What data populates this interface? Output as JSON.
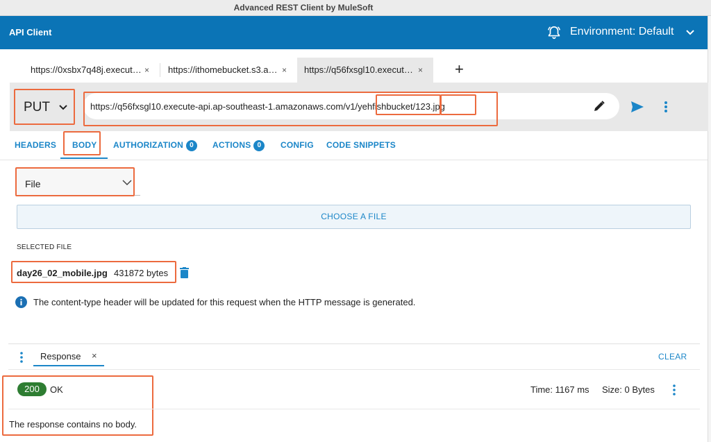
{
  "window": {
    "title": "Advanced REST Client by MuleSoft"
  },
  "header": {
    "app_title": "API Client",
    "environment_label": "Environment: Default",
    "bell_icon": "bell-alert-icon",
    "chevron_icon": "chevron-down-icon"
  },
  "tabs": [
    {
      "label": "https://0xsbx7q48j.execut…",
      "active": false
    },
    {
      "label": "https://ithomebucket.s3.a…",
      "active": false
    },
    {
      "label": "https://q56fxsgl10.execut…",
      "active": true
    }
  ],
  "tab_close_glyph": "×",
  "add_tab_glyph": "+",
  "request": {
    "method": "PUT",
    "url": "https://q56fxsgl10.execute-api.ap-southeast-1.amazonaws.com/v1/yehfishbucket/123.jpg"
  },
  "request_tabs": {
    "headers": "HEADERS",
    "body": "BODY",
    "authorization": "AUTHORIZATION",
    "authorization_count": "0",
    "actions": "ACTIONS",
    "actions_count": "0",
    "config": "CONFIG",
    "code_snippets": "CODE SNIPPETS"
  },
  "body_editor": {
    "type_selected": "File",
    "choose_file_label": "CHOOSE A FILE",
    "selected_file_label": "SELECTED FILE",
    "file_name": "day26_02_mobile.jpg",
    "file_size": "431872 bytes",
    "info_text": "The content-type header will be updated for this request when the HTTP message is generated."
  },
  "response": {
    "tab_label": "Response",
    "close_glyph": "×",
    "clear_label": "CLEAR",
    "status_code": "200",
    "status_text": "OK",
    "time_text": "Time: 1167 ms",
    "size_text": "Size: 0 Bytes",
    "no_body_text": "The response contains no body."
  },
  "colors": {
    "app_bar": "#0b74b6",
    "accent": "#1b86c8",
    "highlight_box": "#ec6a3e",
    "status_success": "#2e7d32"
  }
}
